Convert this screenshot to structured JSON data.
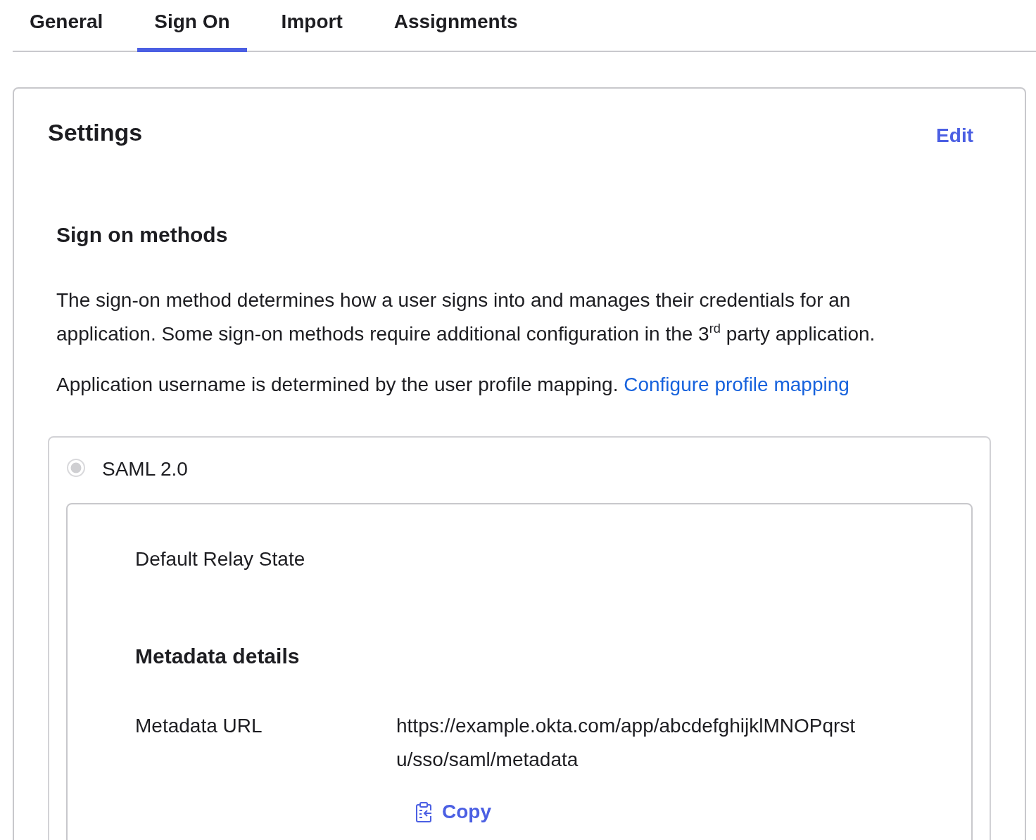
{
  "tabs": [
    {
      "label": "General",
      "selected": false
    },
    {
      "label": "Sign On",
      "selected": true
    },
    {
      "label": "Import",
      "selected": false
    },
    {
      "label": "Assignments",
      "selected": false
    }
  ],
  "settings": {
    "title": "Settings",
    "edit_link": "Edit"
  },
  "sign_on_methods": {
    "heading": "Sign on methods",
    "description": "The sign-on method determines how a user signs into and manages their credentials for an application. Some sign-on methods require additional configuration in the 3$^{rd}$ party application.",
    "username_note": "Application username is determined by the user profile mapping.",
    "mapping_link": "Configure profile mapping"
  },
  "methods": [
    {
      "label": "SAML 2.0",
      "selected": true,
      "disabled": true,
      "details": {
        "fields": [
          {
            "label": "Default Relay State"
          }
        ],
        "metadata": {
          "heading": "Metadata details",
          "url_label": "Metadata URL",
          "url": "https://example.okta.com/app/abcdefghijklMNOPqrstu/sso/saml/metadata",
          "copy_button": "Copy"
        }
      }
    }
  ]
}
